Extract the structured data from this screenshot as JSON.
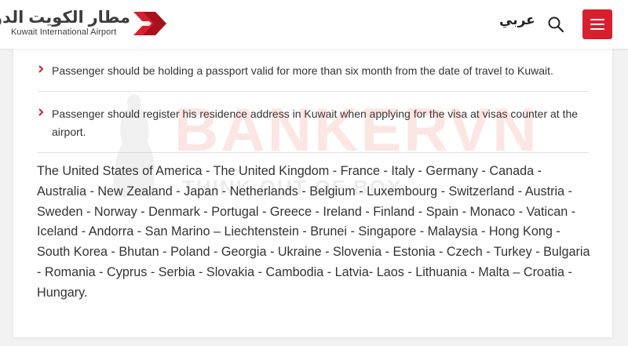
{
  "header": {
    "logo_arabic": "مطار الكويت الدولي",
    "logo_english": "Kuwait International Airport",
    "language_label": "عربي",
    "search_icon": "search-icon",
    "menu_icon": "hamburger-menu-icon",
    "brand_color": "#d6202e"
  },
  "requirements": [
    {
      "text": "Passenger should be holding a passport valid for more than six month from the date of travel to Kuwait."
    },
    {
      "text": "Passenger should register his residence address in Kuwait when applying for the visa at visas counter at the airport."
    }
  ],
  "countries_text": "The United States of America - The United Kingdom - France - Italy - Germany - Canada - Australia - New Zealand - Japan - Netherlands - Belgium - Luxembourg - Switzerland - Austria - Sweden - Norway - Denmark - Portugal - Greece - Ireland - Finland - Spain - Monaco - Vatican - Iceland - Andorra - San Marino – Liechtenstein - Brunei - Singapore - Malaysia - Hong Kong - South Korea - Bhutan - Poland - Georgia - Ukraine - Slovenia - Estonia - Czech - Turkey - Bulgaria - Romania - Cyprus - Serbia - Slovakia - Cambodia - Latvia- Laos - Lithuania - Malta – Croatia - Hungary.",
  "watermark": {
    "main": "BANKERVN",
    "tagline": "THINK OUT OF BOX"
  }
}
